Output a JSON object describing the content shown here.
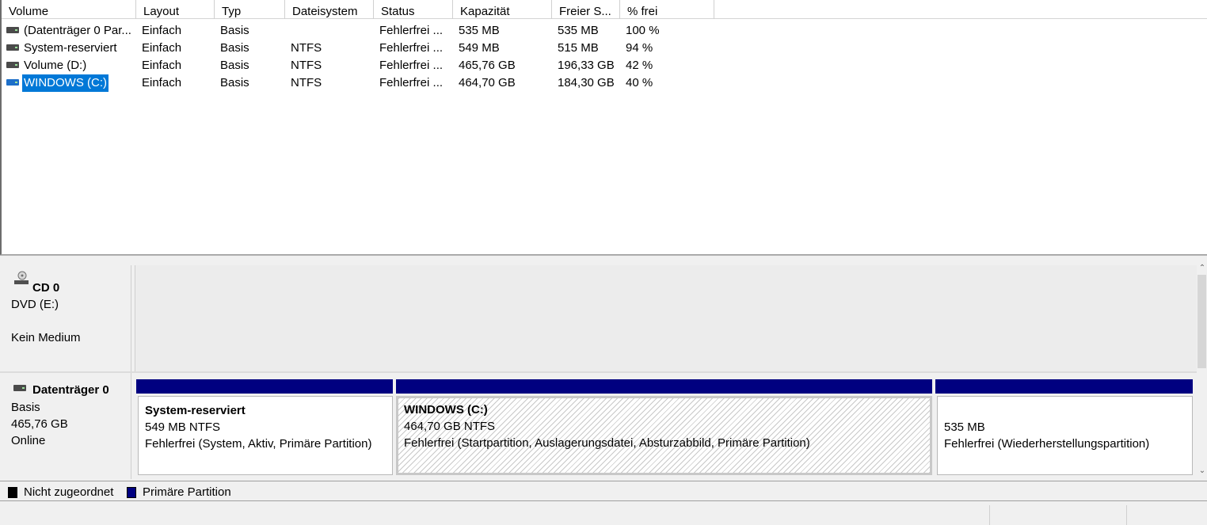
{
  "list": {
    "columns": [
      "Volume",
      "Layout",
      "Typ",
      "Dateisystem",
      "Status",
      "Kapazität",
      "Freier S...",
      "% frei"
    ],
    "rows": [
      {
        "volume": "(Datenträger 0 Par...",
        "layout": "Einfach",
        "typ": "Basis",
        "fs": "",
        "status": "Fehlerfrei ...",
        "cap": "535 MB",
        "free": "535 MB",
        "pct": "100 %"
      },
      {
        "volume": "System-reserviert",
        "layout": "Einfach",
        "typ": "Basis",
        "fs": "NTFS",
        "status": "Fehlerfrei ...",
        "cap": "549 MB",
        "free": "515 MB",
        "pct": "94 %"
      },
      {
        "volume": "Volume (D:)",
        "layout": "Einfach",
        "typ": "Basis",
        "fs": "NTFS",
        "status": "Fehlerfrei ...",
        "cap": "465,76 GB",
        "free": "196,33 GB",
        "pct": "42 %"
      },
      {
        "volume": "WINDOWS (C:)",
        "layout": "Einfach",
        "typ": "Basis",
        "fs": "NTFS",
        "status": "Fehlerfrei ...",
        "cap": "464,70 GB",
        "free": "184,30 GB",
        "pct": "40 %"
      }
    ]
  },
  "cd": {
    "title": "CD 0",
    "drive": "DVD (E:)",
    "media": "Kein Medium"
  },
  "disk0": {
    "title": "Datenträger 0",
    "type": "Basis",
    "size": "465,76 GB",
    "state": "Online",
    "partitions": [
      {
        "name": "System-reserviert",
        "size": "549 MB NTFS",
        "status": "Fehlerfrei (System, Aktiv, Primäre Partition)"
      },
      {
        "name": "WINDOWS  (C:)",
        "size": "464,70 GB NTFS",
        "status": "Fehlerfrei (Startpartition, Auslagerungsdatei, Absturzabbild, Primäre Partition)"
      },
      {
        "name": "",
        "size": "535 MB",
        "status": "Fehlerfrei (Wiederherstellungspartition)"
      }
    ]
  },
  "legend": {
    "unallocated": "Nicht zugeordnet",
    "primary": "Primäre Partition",
    "unallocated_color": "#000000",
    "primary_color": "#000080"
  }
}
